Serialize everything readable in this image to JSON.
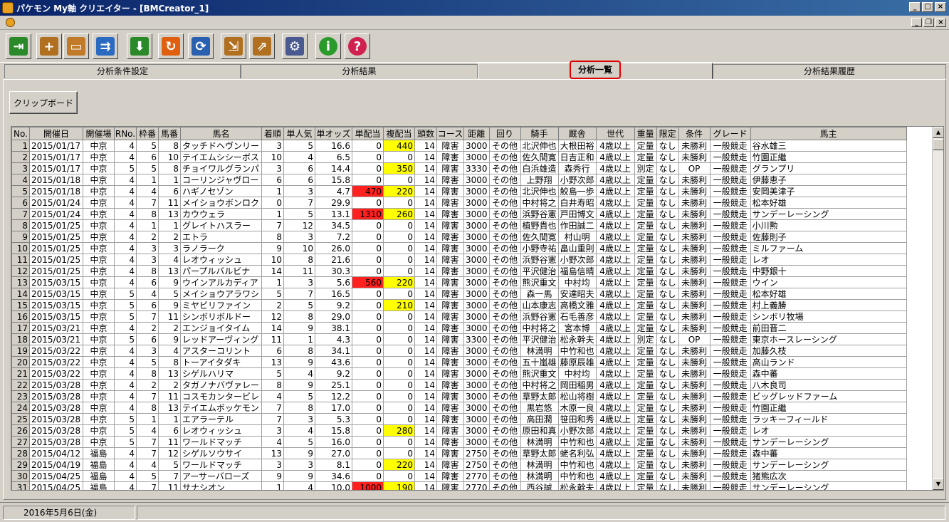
{
  "window": {
    "title": "パケモン My軸 クリエイター - [BMCreator_1]"
  },
  "toolbar": {
    "buttons": [
      {
        "name": "exit-icon",
        "glyph": "⇥",
        "color": "#2a8a2a"
      },
      {
        "name": "new-document-icon",
        "glyph": "+",
        "color": "#b07020"
      },
      {
        "name": "open-folder-icon",
        "glyph": "▭",
        "color": "#c07a28"
      },
      {
        "name": "copy-files-icon",
        "glyph": "⇉",
        "color": "#2a6ac0"
      },
      {
        "name": "download-icon",
        "glyph": "⬇",
        "color": "#2a8a2a"
      },
      {
        "name": "redo-arrow-icon",
        "glyph": "↻",
        "color": "#e06010"
      },
      {
        "name": "refresh-sync-icon",
        "glyph": "⟳",
        "color": "#2a60b0"
      },
      {
        "name": "import-icon",
        "glyph": "⇲",
        "color": "#b07020"
      },
      {
        "name": "export-icon",
        "glyph": "⇗",
        "color": "#b07020"
      },
      {
        "name": "gear-icon",
        "glyph": "⚙",
        "color": "#4a5a90"
      },
      {
        "name": "info-icon",
        "glyph": "i",
        "color": "#2a9a2a"
      },
      {
        "name": "help-icon",
        "glyph": "?",
        "color": "#d02050"
      }
    ]
  },
  "tabs": [
    {
      "label": "分析条件設定"
    },
    {
      "label": "分析結果"
    },
    {
      "label": "分析一覧"
    },
    {
      "label": "分析結果履歴"
    }
  ],
  "clipboard_label": "クリップボード",
  "columns": [
    "No.",
    "開催日",
    "開催場",
    "RNo.",
    "枠番",
    "馬番",
    "馬名",
    "着順",
    "単人気",
    "単オッズ",
    "単配当",
    "複配当",
    "頭数",
    "コース",
    "距離",
    "回り",
    "騎手",
    "厩舎",
    "世代",
    "重量",
    "限定",
    "条件",
    "グレード",
    "馬主"
  ],
  "rows": [
    [
      "1",
      "2015/01/17",
      "中京",
      "4",
      "5",
      "8",
      "タッチドヘヴンリー",
      "3",
      "5",
      "16.6",
      "0",
      "440",
      "14",
      "障害",
      "3000",
      "その他",
      "北沢伸也",
      "大根田裕",
      "4歳以上",
      "定量",
      "なし",
      "未勝利",
      "一般競走",
      "谷水雄三"
    ],
    [
      "2",
      "2015/01/17",
      "中京",
      "4",
      "6",
      "10",
      "テイエムシシーボス",
      "10",
      "4",
      "6.5",
      "0",
      "0",
      "14",
      "障害",
      "3000",
      "その他",
      "佐久間寛",
      "日吉正和",
      "4歳以上",
      "定量",
      "なし",
      "未勝利",
      "一般競走",
      "竹園正繼"
    ],
    [
      "3",
      "2015/01/17",
      "中京",
      "5",
      "5",
      "8",
      "チョイワルグランパ",
      "3",
      "6",
      "14.4",
      "0",
      "350",
      "14",
      "障害",
      "3330",
      "その他",
      "白浜雄造",
      "森秀行",
      "4歳以上",
      "別定",
      "なし",
      "OP",
      "一般競走",
      "グランプリ"
    ],
    [
      "4",
      "2015/01/18",
      "中京",
      "4",
      "1",
      "1",
      "コーリンジャヴロー",
      "6",
      "6",
      "15.8",
      "0",
      "0",
      "14",
      "障害",
      "3000",
      "その他",
      "上野翔",
      "小野次郎",
      "4歳以上",
      "定量",
      "なし",
      "未勝利",
      "一般競走",
      "伊藤恵子"
    ],
    [
      "5",
      "2015/01/18",
      "中京",
      "4",
      "4",
      "6",
      "ハギノセゾン",
      "1",
      "3",
      "4.7",
      "470",
      "220",
      "14",
      "障害",
      "3000",
      "その他",
      "北沢伸也",
      "鮫島一歩",
      "4歳以上",
      "定量",
      "なし",
      "未勝利",
      "一般競走",
      "安岡美津子"
    ],
    [
      "6",
      "2015/01/24",
      "中京",
      "4",
      "7",
      "11",
      "メイショウボンロク",
      "0",
      "7",
      "29.9",
      "0",
      "0",
      "14",
      "障害",
      "3000",
      "その他",
      "中村将之",
      "白井寿昭",
      "4歳以上",
      "定量",
      "なし",
      "未勝利",
      "一般競走",
      "松本好雄"
    ],
    [
      "7",
      "2015/01/24",
      "中京",
      "4",
      "8",
      "13",
      "カウウェラ",
      "1",
      "5",
      "13.1",
      "1310",
      "260",
      "14",
      "障害",
      "3000",
      "その他",
      "浜野谷憲",
      "戸田博文",
      "4歳以上",
      "定量",
      "なし",
      "未勝利",
      "一般競走",
      "サンデーレーシング"
    ],
    [
      "8",
      "2015/01/25",
      "中京",
      "4",
      "1",
      "1",
      "グレイトハスラー",
      "7",
      "12",
      "34.5",
      "0",
      "0",
      "14",
      "障害",
      "3000",
      "その他",
      "植野貴也",
      "作田誠二",
      "4歳以上",
      "定量",
      "なし",
      "未勝利",
      "一般競走",
      "小川勲"
    ],
    [
      "9",
      "2015/01/25",
      "中京",
      "4",
      "2",
      "2",
      "エトラ",
      "8",
      "3",
      "7.2",
      "0",
      "0",
      "14",
      "障害",
      "3000",
      "その他",
      "佐久間寛",
      "村山明",
      "4歳以上",
      "定量",
      "なし",
      "未勝利",
      "一般競走",
      "佐藤則子"
    ],
    [
      "10",
      "2015/01/25",
      "中京",
      "4",
      "3",
      "3",
      "ラノラーク",
      "9",
      "10",
      "26.0",
      "0",
      "0",
      "14",
      "障害",
      "3000",
      "その他",
      "小野寺祐",
      "畠山重則",
      "4歳以上",
      "定量",
      "なし",
      "未勝利",
      "一般競走",
      "ミルファーム"
    ],
    [
      "11",
      "2015/01/25",
      "中京",
      "4",
      "3",
      "4",
      "レオウィッシュ",
      "10",
      "8",
      "21.6",
      "0",
      "0",
      "14",
      "障害",
      "3000",
      "その他",
      "浜野谷憲",
      "小野次郎",
      "4歳以上",
      "定量",
      "なし",
      "未勝利",
      "一般競走",
      "レオ"
    ],
    [
      "12",
      "2015/01/25",
      "中京",
      "4",
      "8",
      "13",
      "パープルバルビナ",
      "14",
      "11",
      "30.3",
      "0",
      "0",
      "14",
      "障害",
      "3000",
      "その他",
      "平沢健治",
      "福島信晴",
      "4歳以上",
      "定量",
      "なし",
      "未勝利",
      "一般競走",
      "中野銀十"
    ],
    [
      "13",
      "2015/03/15",
      "中京",
      "4",
      "6",
      "9",
      "ウインアルカディア",
      "1",
      "3",
      "5.6",
      "560",
      "220",
      "14",
      "障害",
      "3000",
      "その他",
      "熊沢重文",
      "中村均",
      "4歳以上",
      "定量",
      "なし",
      "未勝利",
      "一般競走",
      "ウイン"
    ],
    [
      "14",
      "2015/03/15",
      "中京",
      "5",
      "4",
      "5",
      "メイショウアラワシ",
      "5",
      "7",
      "16.5",
      "0",
      "0",
      "14",
      "障害",
      "3000",
      "その他",
      "森一馬",
      "安達昭夫",
      "4歳以上",
      "定量",
      "なし",
      "未勝利",
      "一般競走",
      "松本好雄"
    ],
    [
      "15",
      "2015/03/15",
      "中京",
      "5",
      "6",
      "9",
      "ミヤビリファイン",
      "2",
      "5",
      "9.2",
      "0",
      "210",
      "14",
      "障害",
      "3000",
      "その他",
      "山本康志",
      "高橋文雅",
      "4歳以上",
      "定量",
      "なし",
      "未勝利",
      "一般競走",
      "村上義勝"
    ],
    [
      "16",
      "2015/03/15",
      "中京",
      "5",
      "7",
      "11",
      "シンボリボルドー",
      "12",
      "8",
      "29.0",
      "0",
      "0",
      "14",
      "障害",
      "3000",
      "その他",
      "浜野谷憲",
      "石毛善彦",
      "4歳以上",
      "定量",
      "なし",
      "未勝利",
      "一般競走",
      "シンボリ牧場"
    ],
    [
      "17",
      "2015/03/21",
      "中京",
      "4",
      "2",
      "2",
      "エンジョイタイム",
      "14",
      "9",
      "38.1",
      "0",
      "0",
      "14",
      "障害",
      "3000",
      "その他",
      "中村将之",
      "宮本博",
      "4歳以上",
      "定量",
      "なし",
      "未勝利",
      "一般競走",
      "前田晋二"
    ],
    [
      "18",
      "2015/03/21",
      "中京",
      "5",
      "6",
      "9",
      "レッドアーヴィング",
      "11",
      "1",
      "4.3",
      "0",
      "0",
      "14",
      "障害",
      "3300",
      "その他",
      "平沢健治",
      "松永幹夫",
      "4歳以上",
      "別定",
      "なし",
      "OP",
      "一般競走",
      "東京ホースレーシング"
    ],
    [
      "19",
      "2015/03/22",
      "中京",
      "4",
      "3",
      "4",
      "アスターコリント",
      "6",
      "8",
      "34.1",
      "0",
      "0",
      "14",
      "障害",
      "3000",
      "その他",
      "林満明",
      "中竹和也",
      "4歳以上",
      "定量",
      "なし",
      "未勝利",
      "一般競走",
      "加藤久枝"
    ],
    [
      "20",
      "2015/03/22",
      "中京",
      "4",
      "5",
      "8",
      "トーアイタダキ",
      "13",
      "9",
      "43.6",
      "0",
      "0",
      "14",
      "障害",
      "3000",
      "その他",
      "五十嵐雄",
      "藤原辰雄",
      "4歳以上",
      "定量",
      "なし",
      "未勝利",
      "一般競走",
      "高山ランド"
    ],
    [
      "21",
      "2015/03/22",
      "中京",
      "4",
      "8",
      "13",
      "シゲルハリマ",
      "5",
      "4",
      "9.2",
      "0",
      "0",
      "14",
      "障害",
      "3000",
      "その他",
      "熊沢重文",
      "中村均",
      "4歳以上",
      "定量",
      "なし",
      "未勝利",
      "一般競走",
      "森中蕃"
    ],
    [
      "22",
      "2015/03/28",
      "中京",
      "4",
      "2",
      "2",
      "タガノナバヴァレー",
      "8",
      "9",
      "25.1",
      "0",
      "0",
      "14",
      "障害",
      "3000",
      "その他",
      "中村将之",
      "岡田稲男",
      "4歳以上",
      "定量",
      "なし",
      "未勝利",
      "一般競走",
      "八木良司"
    ],
    [
      "23",
      "2015/03/28",
      "中京",
      "4",
      "7",
      "11",
      "コスモカンタービレ",
      "4",
      "5",
      "12.2",
      "0",
      "0",
      "14",
      "障害",
      "3000",
      "その他",
      "草野太郎",
      "松山将樹",
      "4歳以上",
      "定量",
      "なし",
      "未勝利",
      "一般競走",
      "ビッグレッドファーム"
    ],
    [
      "24",
      "2015/03/28",
      "中京",
      "4",
      "8",
      "13",
      "テイエムボッケモン",
      "7",
      "8",
      "17.0",
      "0",
      "0",
      "14",
      "障害",
      "3000",
      "その他",
      "黒岩悠",
      "木原一良",
      "4歳以上",
      "定量",
      "なし",
      "未勝利",
      "一般競走",
      "竹園正繼"
    ],
    [
      "25",
      "2015/03/28",
      "中京",
      "5",
      "1",
      "1",
      "エアラーテル",
      "7",
      "3",
      "5.3",
      "0",
      "0",
      "14",
      "障害",
      "3000",
      "その他",
      "高田潤",
      "笹田和秀",
      "4歳以上",
      "定量",
      "なし",
      "未勝利",
      "一般競走",
      "ラッキーフィールド"
    ],
    [
      "26",
      "2015/03/28",
      "中京",
      "5",
      "4",
      "6",
      "レオウィッシュ",
      "3",
      "4",
      "15.8",
      "0",
      "280",
      "14",
      "障害",
      "3000",
      "その他",
      "原田和真",
      "小野次郎",
      "4歳以上",
      "定量",
      "なし",
      "未勝利",
      "一般競走",
      "レオ"
    ],
    [
      "27",
      "2015/03/28",
      "中京",
      "5",
      "7",
      "11",
      "ワールドマッチ",
      "4",
      "5",
      "16.0",
      "0",
      "0",
      "14",
      "障害",
      "3000",
      "その他",
      "林満明",
      "中竹和也",
      "4歳以上",
      "定量",
      "なし",
      "未勝利",
      "一般競走",
      "サンデーレーシング"
    ],
    [
      "28",
      "2015/04/12",
      "福島",
      "4",
      "7",
      "12",
      "シゲルソウサイ",
      "13",
      "9",
      "27.0",
      "0",
      "0",
      "14",
      "障害",
      "2750",
      "その他",
      "草野太郎",
      "蛯名利弘",
      "4歳以上",
      "定量",
      "なし",
      "未勝利",
      "一般競走",
      "森中蕃"
    ],
    [
      "29",
      "2015/04/19",
      "福島",
      "4",
      "4",
      "5",
      "ワールドマッチ",
      "3",
      "3",
      "8.1",
      "0",
      "220",
      "14",
      "障害",
      "2750",
      "その他",
      "林満明",
      "中竹和也",
      "4歳以上",
      "定量",
      "なし",
      "未勝利",
      "一般競走",
      "サンデーレーシング"
    ],
    [
      "30",
      "2015/04/25",
      "福島",
      "4",
      "5",
      "7",
      "アーサーバローズ",
      "9",
      "9",
      "34.6",
      "0",
      "0",
      "14",
      "障害",
      "2770",
      "その他",
      "林満明",
      "中竹和也",
      "4歳以上",
      "定量",
      "なし",
      "未勝利",
      "一般競走",
      "猪熊広次"
    ],
    [
      "31",
      "2015/04/25",
      "福島",
      "4",
      "7",
      "11",
      "サナシオン",
      "1",
      "4",
      "10.0",
      "1000",
      "190",
      "14",
      "障害",
      "2770",
      "その他",
      "西谷誠",
      "松永幹夫",
      "4歳以上",
      "定量",
      "なし",
      "未勝利",
      "一般競走",
      "サンデーレーシング"
    ]
  ],
  "status": {
    "date": "2016年5月6日(金)"
  }
}
